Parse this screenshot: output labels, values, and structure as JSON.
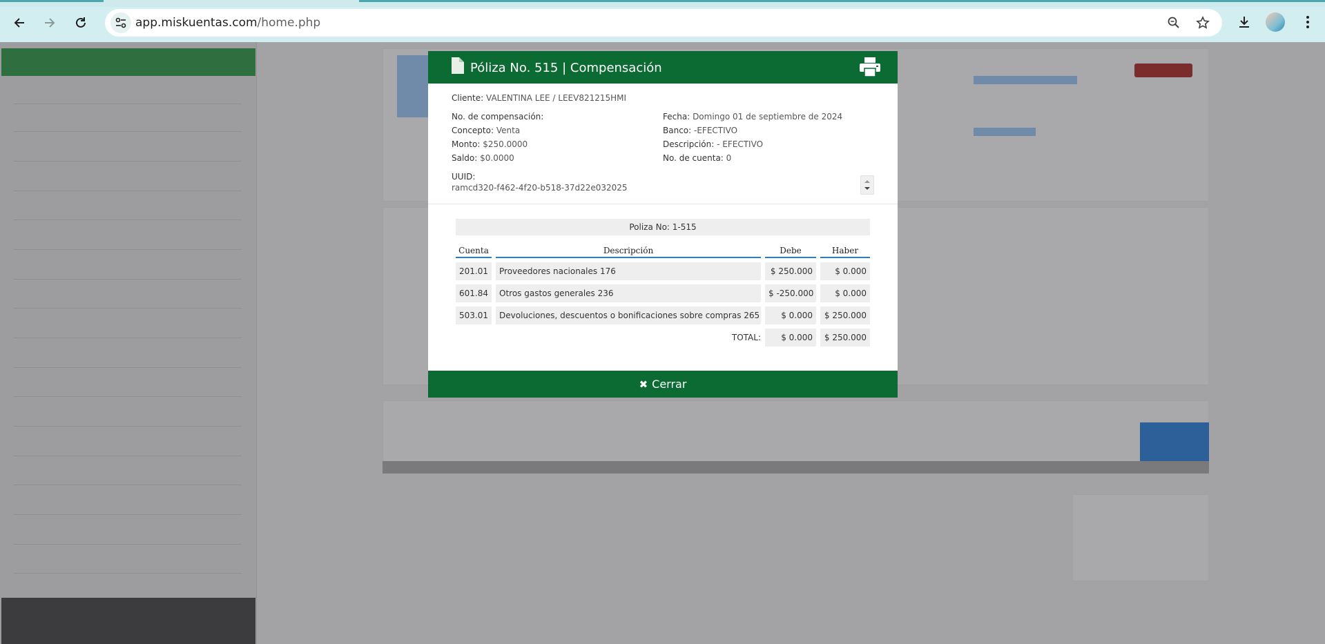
{
  "browser": {
    "url_host": "app.miskuentas.com",
    "url_path": "/home.php"
  },
  "modal": {
    "title": "Póliza No. 515 | Compensación",
    "cliente_label": "Cliente:",
    "cliente_value": "VALENTINA LEE / LEEV821215HMI",
    "left_fields": [
      {
        "label": "No. de compensación:",
        "value": ""
      },
      {
        "label": "Concepto:",
        "value": "Venta"
      },
      {
        "label": "Monto:",
        "value": "$250.0000"
      },
      {
        "label": "Saldo:",
        "value": "$0.0000"
      }
    ],
    "right_fields": [
      {
        "label": "Fecha:",
        "value": "Domingo 01 de septiembre de 2024"
      },
      {
        "label": "Banco:",
        "value": "-EFECTIVO"
      },
      {
        "label": "Descripción:",
        "value": "- EFECTIVO"
      },
      {
        "label": "No. de cuenta:",
        "value": "0"
      }
    ],
    "uuid_label": "UUID:",
    "uuid_value": "ramcd320-f462-4f20-b518-37d22e032025",
    "poliza_no": "Poliza No: 1-515",
    "table": {
      "headers": [
        "Cuenta",
        "Descripción",
        "Debe",
        "Haber"
      ],
      "rows": [
        {
          "cuenta": "201.01",
          "descripcion": "Proveedores nacionales 176",
          "debe": "$ 250.000",
          "haber": "$ 0.000"
        },
        {
          "cuenta": "601.84",
          "descripcion": "Otros gastos generales 236",
          "debe": "$ -250.000",
          "haber": "$ 0.000"
        },
        {
          "cuenta": "503.01",
          "descripcion": "Devoluciones, descuentos o bonificaciones sobre compras 265",
          "debe": "$ 0.000",
          "haber": "$ 250.000"
        }
      ],
      "total_label": "TOTAL:",
      "total_debe": "$ 0.000",
      "total_haber": "$ 250.000"
    },
    "close_label": "Cerrar"
  },
  "icons": {
    "back": "back-arrow-icon",
    "forward": "forward-arrow-icon",
    "reload": "reload-icon",
    "site_info": "site-info-icon",
    "zoom": "zoom-icon",
    "bookmark": "star-icon",
    "download": "download-icon",
    "menu": "kebab-menu-icon",
    "document": "document-icon",
    "print": "printer-icon",
    "close": "close-icon"
  },
  "colors": {
    "header_green": "#0b6b33",
    "table_underline": "#2a7ec0",
    "chrome_bg": "#d3eef0",
    "overlay": "#9b9b9d"
  }
}
